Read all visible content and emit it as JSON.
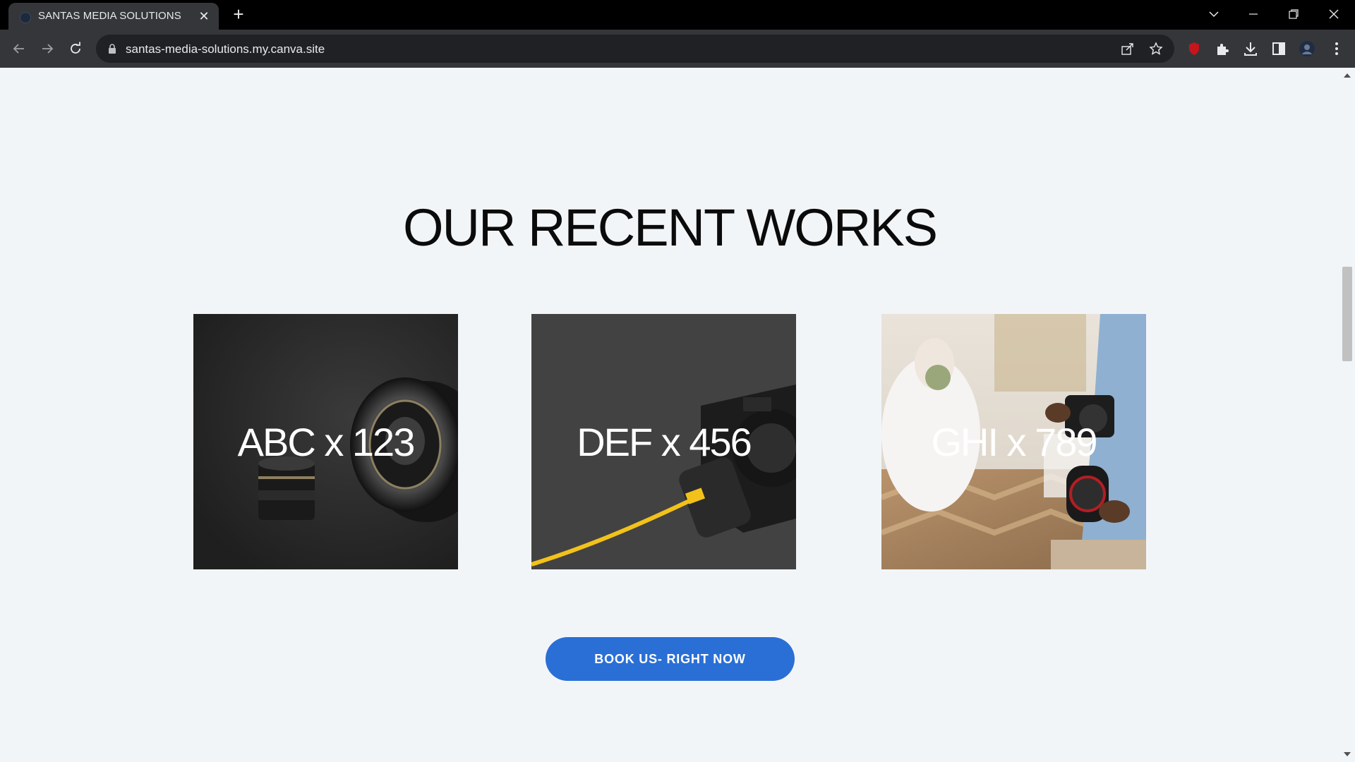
{
  "browser": {
    "tab_title": "SANTAS MEDIA SOLUTIONS",
    "url": "santas-media-solutions.my.canva.site"
  },
  "page": {
    "heading": "OUR RECENT WORKS",
    "cards": [
      {
        "label": "ABC x 123"
      },
      {
        "label": "DEF x 456"
      },
      {
        "label": "GHI x 789"
      }
    ],
    "cta_label": "BOOK US- RIGHT NOW"
  },
  "colors": {
    "page_background": "#f2f5f8",
    "cta_background": "#2a6fd6",
    "heading_text": "#0b0b0b"
  }
}
